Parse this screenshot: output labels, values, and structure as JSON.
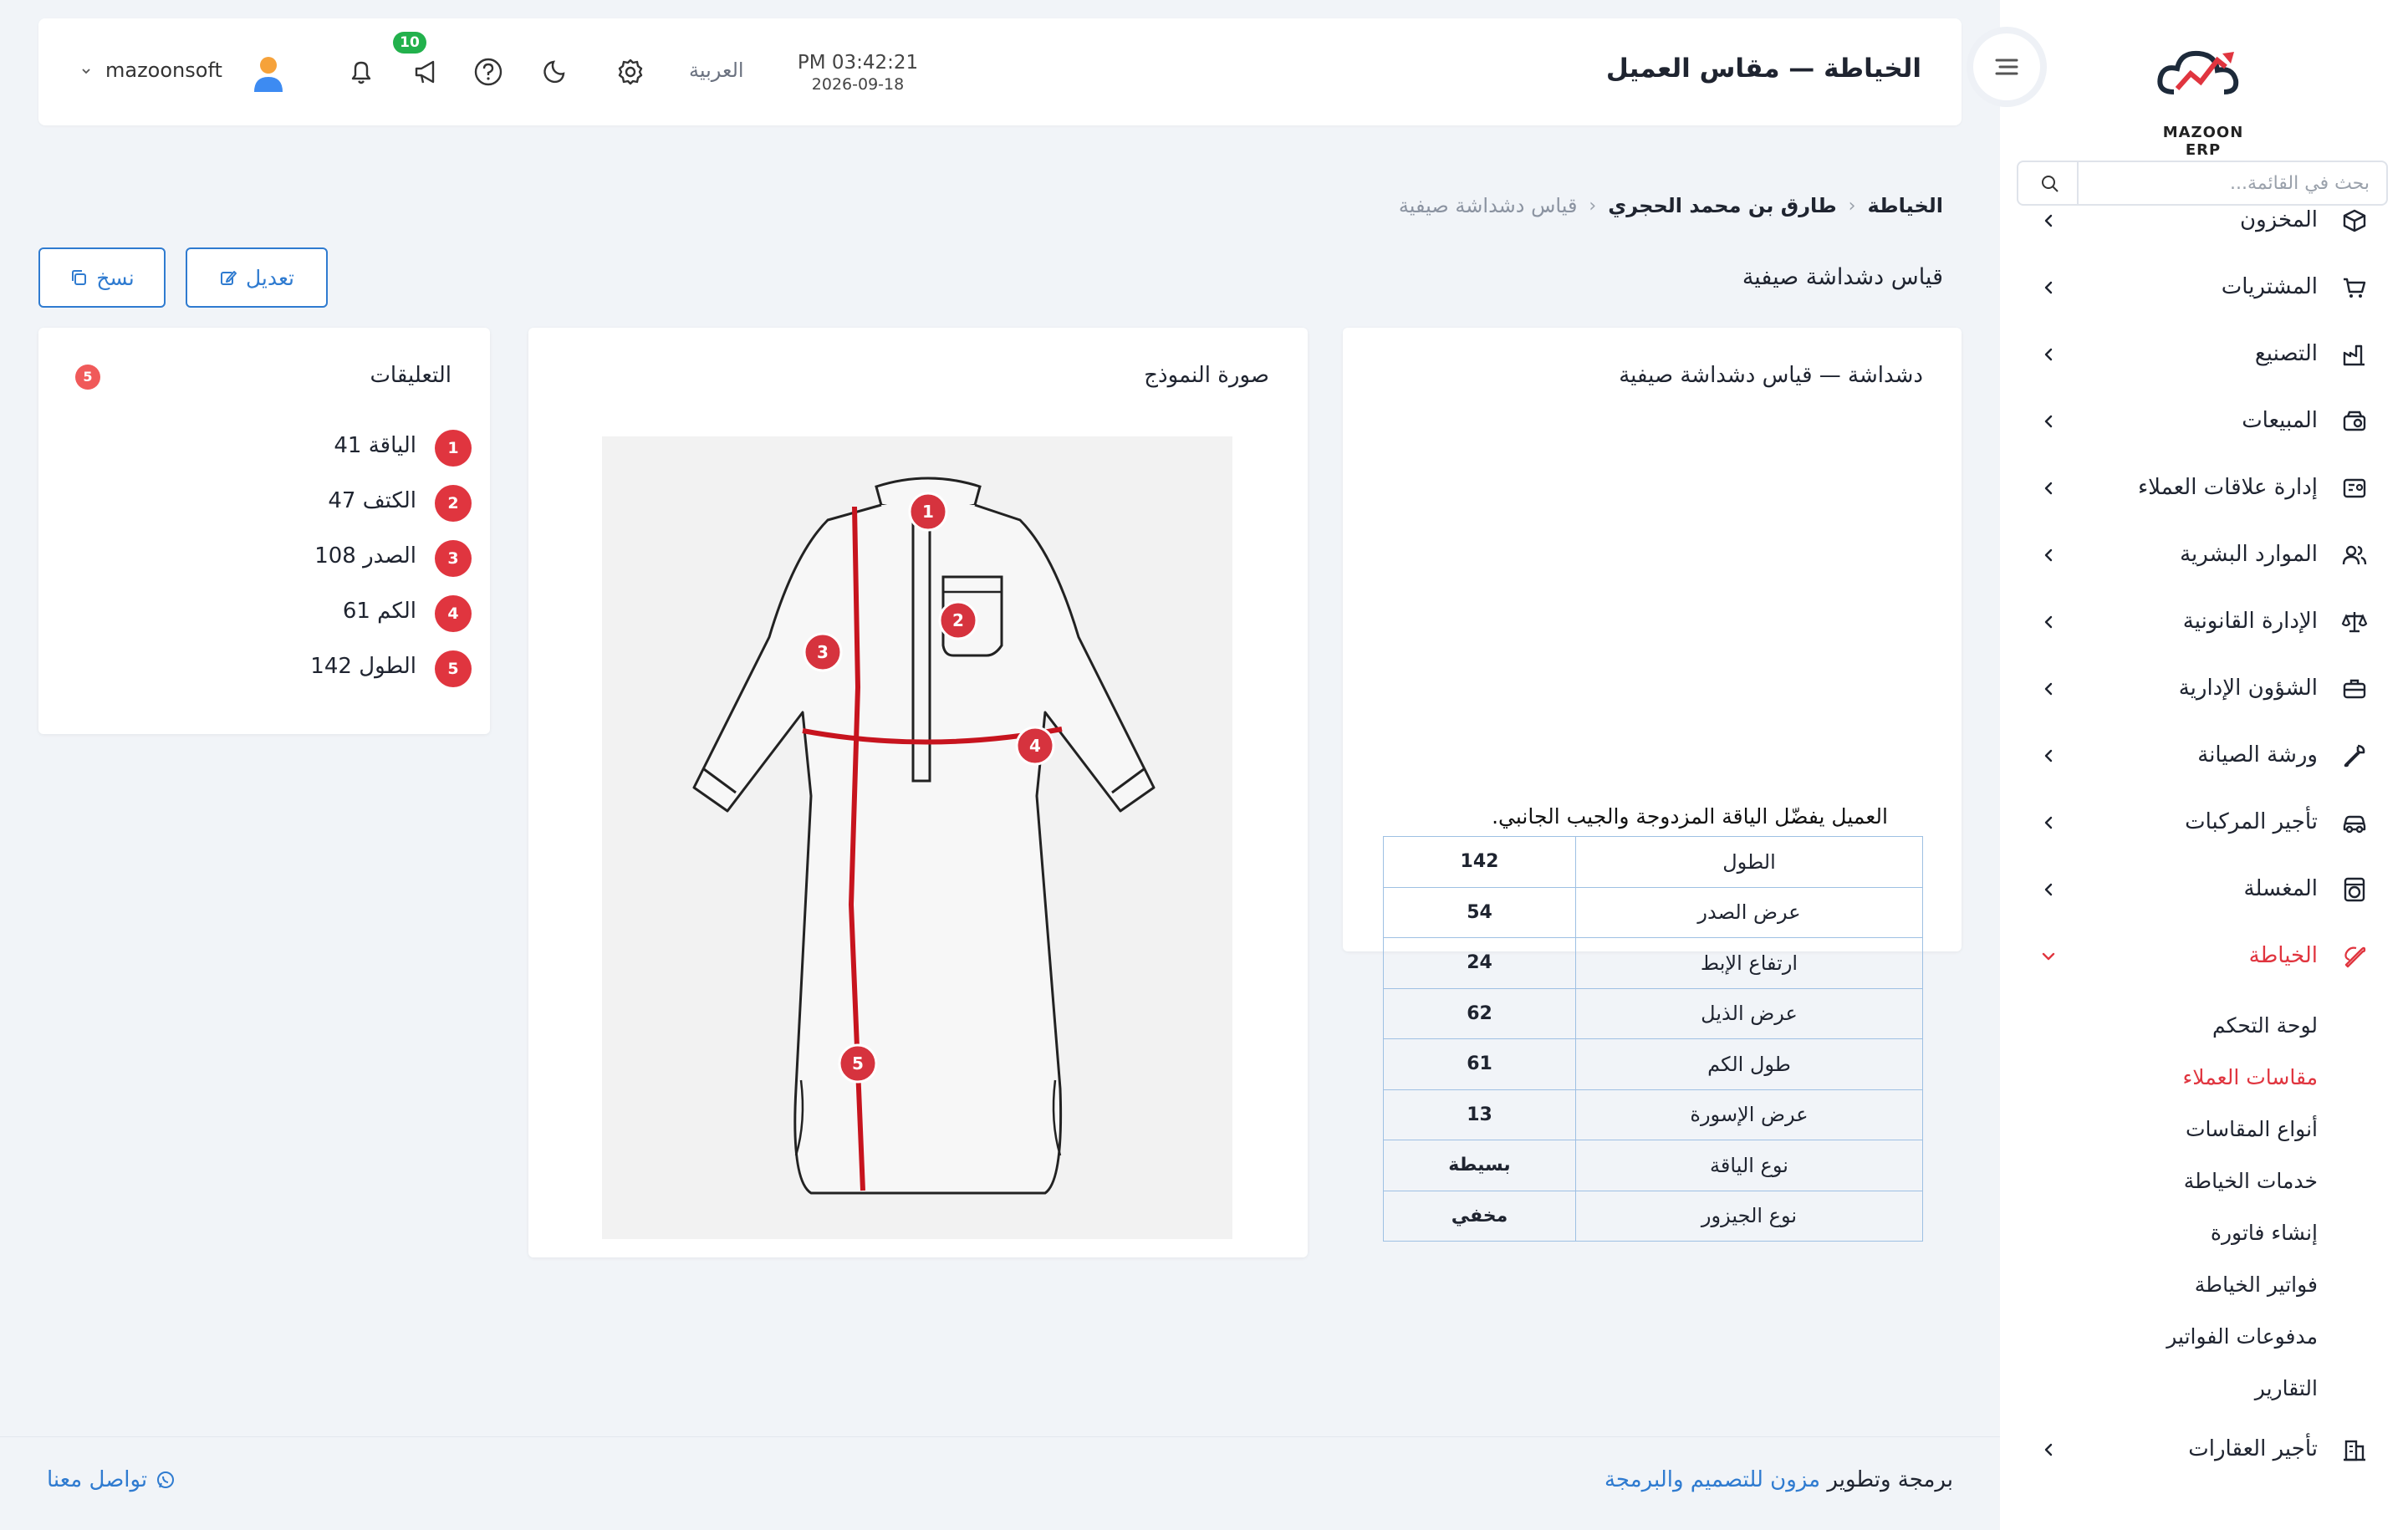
{
  "brand": {
    "logo_text": "MAZOON ERP"
  },
  "search": {
    "placeholder": "بحث في القائمة..."
  },
  "menu": [
    {
      "label": "المخزون",
      "icon": "box-icon"
    },
    {
      "label": "المشتريات",
      "icon": "cart-icon"
    },
    {
      "label": "التصنيع",
      "icon": "factory-icon"
    },
    {
      "label": "المبيعات",
      "icon": "register-icon"
    },
    {
      "label": "إدارة علاقات العملاء",
      "icon": "id-card-icon"
    },
    {
      "label": "الموارد البشرية",
      "icon": "users-icon"
    },
    {
      "label": "الإدارة القانونية",
      "icon": "scale-icon"
    },
    {
      "label": "الشؤون الإدارية",
      "icon": "briefcase-icon"
    },
    {
      "label": "ورشة الصيانة",
      "icon": "wrench-icon"
    },
    {
      "label": "تأجير المركبات",
      "icon": "car-icon"
    },
    {
      "label": "المغسلة",
      "icon": "washer-icon"
    },
    {
      "label": "الخياطة",
      "icon": "needle-icon"
    }
  ],
  "submenu": [
    {
      "label": "لوحة التحكم"
    },
    {
      "label": "مقاسات العملاء"
    },
    {
      "label": "أنواع المقاسات"
    },
    {
      "label": "خدمات الخياطة"
    },
    {
      "label": "إنشاء فاتورة"
    },
    {
      "label": "فواتير الخياطة"
    },
    {
      "label": "مدفوعات الفواتير"
    },
    {
      "label": "التقارير"
    }
  ],
  "menu_last": {
    "label": "تأجير العقارات",
    "icon": "building-icon"
  },
  "header": {
    "title": "الخياطة — مقاس العميل",
    "time": "PM 03:42:21",
    "date": "2026-09-18",
    "language": "العربية",
    "notifications_badge": "10",
    "username": "mazoonsoft"
  },
  "breadcrumb": {
    "c1": "الخياطة",
    "c2": "طارق بن محمد الحجري",
    "c3": "قياس دشداشة صيفية"
  },
  "page": {
    "subtitle": "قياس دشداشة صيفية",
    "edit_label": "تعديل",
    "copy_label": "نسخ"
  },
  "measure_card": {
    "title": "دشداشة — قياس دشداشة صيفية",
    "note": "العميل يفضّل الياقة المزدوجة والجيب الجانبي.",
    "rows": [
      {
        "name": "الطول",
        "value": "142"
      },
      {
        "name": "عرض الصدر",
        "value": "54"
      },
      {
        "name": "ارتفاع الإبط",
        "value": "24"
      },
      {
        "name": "عرض الذيل",
        "value": "62"
      },
      {
        "name": "طول الكم",
        "value": "61"
      },
      {
        "name": "عرض الإسورة",
        "value": "13"
      },
      {
        "name": "نوع الياقة",
        "value": "بسيطة"
      },
      {
        "name": "نوع الجيزور",
        "value": "مخفي"
      }
    ]
  },
  "image_card": {
    "title": "صورة النموذج",
    "markers": [
      "1",
      "2",
      "3",
      "4",
      "5"
    ]
  },
  "comments_card": {
    "title": "التعليقات",
    "count": "5",
    "items": [
      {
        "num": "1",
        "text": "الياقة 41"
      },
      {
        "num": "2",
        "text": "الكتف 47"
      },
      {
        "num": "3",
        "text": "الصدر 108"
      },
      {
        "num": "4",
        "text": "الكم 61"
      },
      {
        "num": "5",
        "text": "الطول 142"
      }
    ]
  },
  "footer": {
    "prefix": "برمجة وتطوير",
    "link": "مزون للتصميم والبرمجة",
    "contact": "تواصل معنا"
  },
  "colors": {
    "accent": "#2f7bd0",
    "active": "#e0353f",
    "badge_green": "#22b14c"
  }
}
